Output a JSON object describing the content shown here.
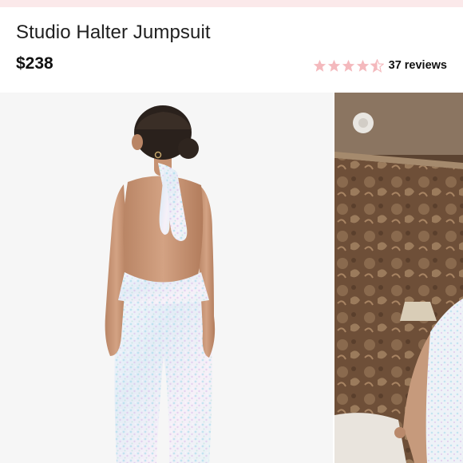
{
  "product": {
    "title": "Studio Halter Jumpsuit",
    "price": "$238"
  },
  "rating": {
    "value": 4.5,
    "max": 5,
    "reviews_label": "37 reviews",
    "star_color": "#f4b9bd"
  },
  "gallery": {
    "images": [
      {
        "description_icon": "product-photo-back-view"
      },
      {
        "description_icon": "product-photo-lifestyle"
      }
    ]
  },
  "colors": {
    "top_strip": "#fbe9ea",
    "text": "#1f1f1f"
  }
}
